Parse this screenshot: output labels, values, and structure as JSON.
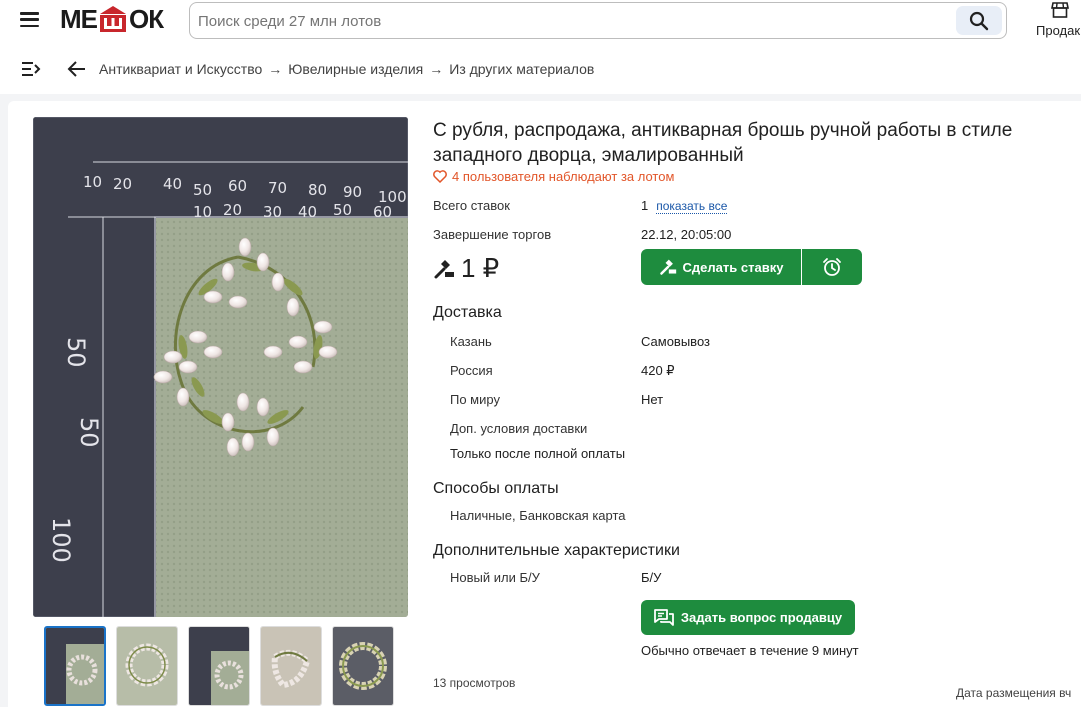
{
  "header": {
    "logo_text": "МЕШОК",
    "search_placeholder": "Поиск среди 27 млн лотов",
    "sell_label": "Продак"
  },
  "breadcrumb": {
    "items": [
      "Антиквариат и Искусство",
      "Ювелирные изделия",
      "Из других материалов"
    ],
    "separator": "→"
  },
  "lot": {
    "title": "С рубля, распродажа, антикварная брошь ручной работы в стиле западного дворца, эмалированный",
    "watchers": "4 пользователя наблюдают за лотом",
    "total_bids_label": "Всего ставок",
    "total_bids_value": "1",
    "show_all_link": "показать все",
    "end_label": "Завершение торгов",
    "end_value": "22.12, 20:05:00",
    "price": "1 ₽",
    "bid_button": "Сделать ставку"
  },
  "delivery": {
    "heading": "Доставка",
    "rows": [
      {
        "label": "Казань",
        "value": "Самовывоз"
      },
      {
        "label": "Россия",
        "value": "420 ₽"
      },
      {
        "label": "По миру",
        "value": "Нет"
      }
    ],
    "extra_label": "Доп. условия доставки",
    "extra_note": "Только после полной оплаты"
  },
  "payment": {
    "heading": "Способы оплаты",
    "methods": "Наличные, Банковская карта"
  },
  "characteristics": {
    "heading": "Дополнительные характеристики",
    "rows": [
      {
        "label": "Новый или Б/У",
        "value": "Б/У"
      }
    ]
  },
  "seller": {
    "ask_button": "Задать вопрос продавцу",
    "reply_note": "Обычно отвечает в течение 9 минут"
  },
  "footer": {
    "views": "13 просмотров",
    "posted": "Дата размещения вч"
  },
  "colors": {
    "accent_green": "#1e8c3e",
    "watch_orange": "#e2562a",
    "link_blue": "#1a57a8"
  }
}
